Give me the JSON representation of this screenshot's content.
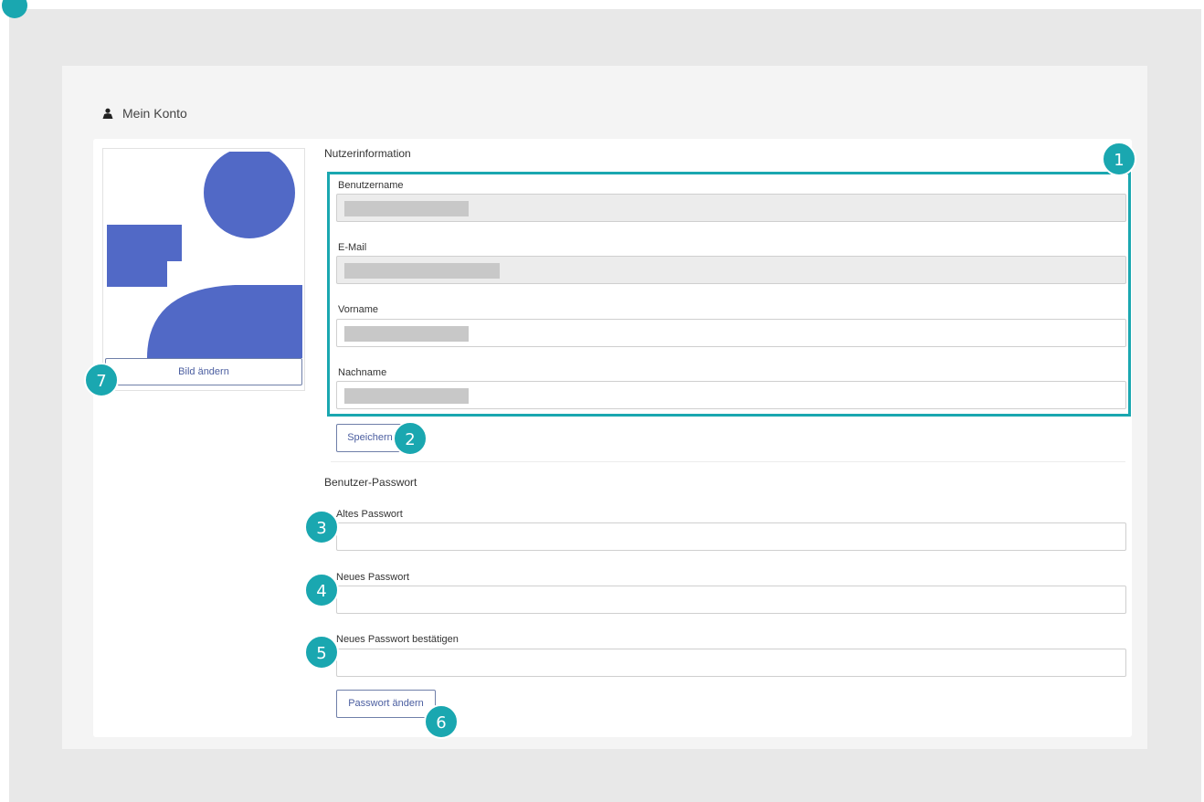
{
  "header": {
    "title": "Mein Konto",
    "icon": "user-icon"
  },
  "avatar": {
    "change_label": "Bild ändern",
    "color": "#5169c6"
  },
  "user_info": {
    "section_title": "Nutzerinformation",
    "fields": [
      {
        "label": "Benutzername",
        "value": "",
        "disabled": true
      },
      {
        "label": "E-Mail",
        "value": "",
        "disabled": true
      },
      {
        "label": "Vorname",
        "value": "",
        "disabled": false
      },
      {
        "label": "Nachname",
        "value": "",
        "disabled": false
      }
    ],
    "save_label": "Speichern"
  },
  "password": {
    "section_title": "Benutzer-Passwort",
    "fields": [
      {
        "label": "Altes Passwort"
      },
      {
        "label": "Neues Passwort"
      },
      {
        "label": "Neues Passwort bestätigen"
      }
    ],
    "change_label": "Passwort ändern"
  },
  "badges": [
    "1",
    "2",
    "3",
    "4",
    "5",
    "6",
    "7"
  ],
  "colors": {
    "accent": "#1aa7b0",
    "button_border": "#6f7fa9",
    "button_text": "#4b5ea0"
  }
}
